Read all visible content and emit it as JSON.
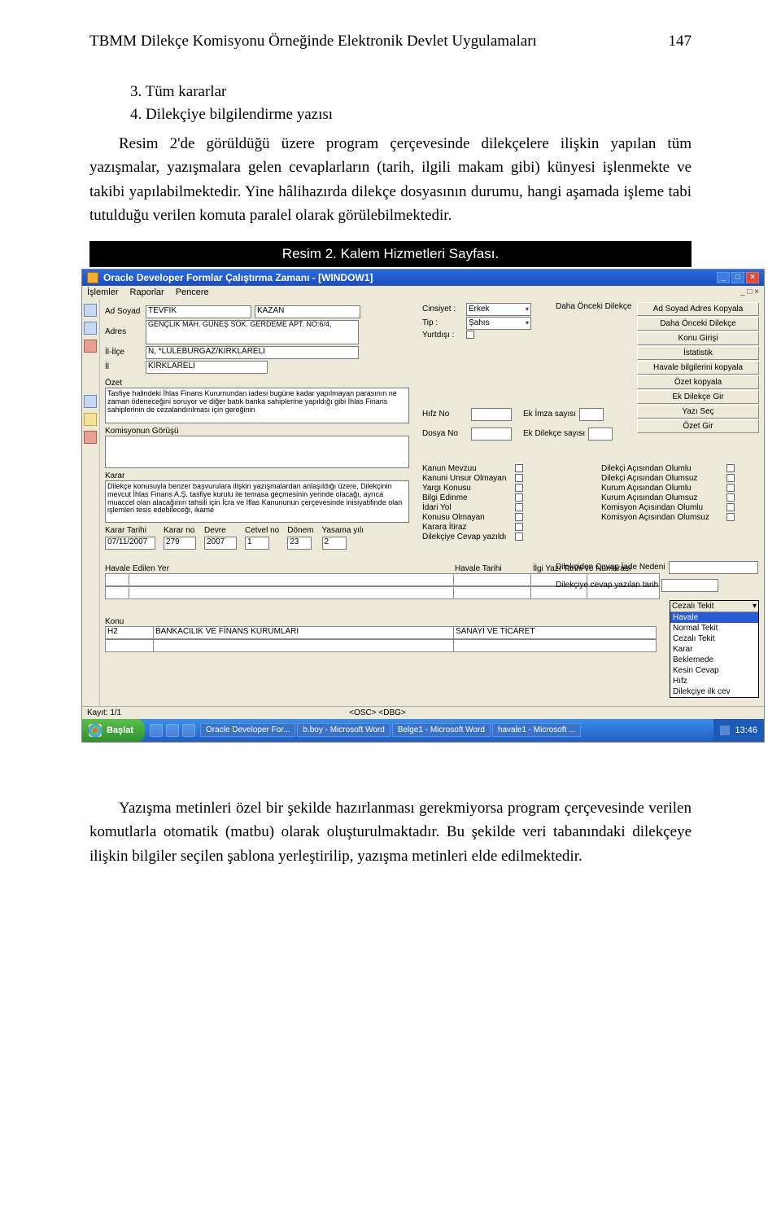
{
  "header": {
    "title": "TBMM Dilekçe Komisyonu Örneğinde Elektronik Devlet Uygulamaları",
    "page": "147"
  },
  "list": {
    "i3": "3. Tüm kararlar",
    "i4": "4. Dilekçiye bilgilendirme yazısı"
  },
  "para1": "Resim 2'de görüldüğü üzere program çerçevesinde dilekçelere ilişkin yapılan tüm yazışmalar, yazışmalara gelen cevaplarların (tarih, ilgili makam gibi) künyesi işlenmekte ve takibi yapılabilmektedir. Yine hâlihazırda dilekçe dosyasının durumu, hangi aşamada işleme tabi tutulduğu verilen komuta paralel olarak görülebilmektedir.",
  "caption": "Resim 2. Kalem Hizmetleri Sayfası.",
  "window": {
    "title": "Oracle Developer Formlar Çalıştırma Zamanı - [WINDOW1]"
  },
  "menu": {
    "m1": "İşlemler",
    "m2": "Raporlar",
    "m3": "Pencere"
  },
  "labels": {
    "ad": "Ad Soyad",
    "adres": "Adres",
    "ililce": "İl-İlçe",
    "il": "İl",
    "cins": "Cinsiyet :",
    "tip": "Tip       :",
    "yurt": "Yurtdışı :",
    "daha": "Daha Önceki Dilekçe",
    "ozet": "Özet",
    "hifz": "Hıfz No",
    "dosya": "Dosya No",
    "ekimza": "Ek İmza sayısı",
    "ekdilek": "Ek Dilekçe sayısı",
    "komgor": "Komisyonun Görüşü",
    "karar": "Karar",
    "kanmevzu": "Kanun Mevzuu",
    "kanuns": "Kanuni Unsur Olmayan",
    "yargi": "Yargı Konusu",
    "bilgi": "Bilgi Edinme",
    "idari": "İdari Yol",
    "konol": "Konusu Olmayan",
    "itiraz": "Karara  İtiraz",
    "cevapyaz": "Dilekçiye Cevap yazıldı",
    "dkolum": "Dilekçi Açısından Olumlu",
    "dkolumz": "Dilekçi Açısından Olumsuz",
    "kuolum": "Kurum Açısından Olumlu",
    "kuolumz": "Kurum Açısından Olumsuz",
    "koolum": "Komisyon Açısından Olumlu",
    "koolumz": "Komisyon Açısından Olumsuz",
    "ktarih": "Karar Tarihi",
    "kno": "Karar no",
    "devre": "Devre",
    "cetvel": "Cetvel no",
    "donem": "Dönem",
    "yasama": "Yasama yılı",
    "dilcevap": "Dilekçiden Cevap İade Nedeni",
    "dilcevtar": "Dilekçiye cevap yazılan tarih",
    "havedilen": "Havale Edilen Yer",
    "havtarih": "Havale Tarihi",
    "ilgiyazi": "İlgi Yazı Tarihi ve Numarası",
    "konu": "Konu"
  },
  "form": {
    "ad1": "TEVFİK",
    "ad2": "KAZAN",
    "adres": "GENÇLİK MAH. GÜNEŞ SOK. GERDEME APT. NO:6/4,",
    "ililce": "N, *LÜLEBURGAZ/KIRKLARELİ",
    "il": "KIRKLARELİ",
    "cins": "Erkek",
    "tip": "Şahıs",
    "ozet": "Tasfiye halindeki İhlas Finans Kurumundan iadesi bugüne kadar yapılmayan parasının ne zaman ödeneceğini soruyor ve diğer batık banka sahiplerine yapıldığı gibi İhlas Finans sahiplerinin de cezalandırılması için gereğinin",
    "komgor": "",
    "karar": "Dilekçe konusuyla benzer başvurulara ilişkin yazışmalardan anlaşıldığı üzere, Dilekçinin mevcut İhlas Finans A.Ş. tasfiye kurulu ile temasa geçmesinin yerinde olacağı, ayrıca muaccel olan alacağının tahsili için İcra ve İflas Kanununun çerçevesinde inisiyatifinde olan işlemleri tesis edebileceği, ikame",
    "ktarih": "07/11/2007",
    "kno": "279",
    "devre": "2007",
    "cetvel": "1",
    "donem": "23",
    "yasama": "2",
    "konu1": "H2",
    "konu2": "BANKACILIK VE FİNANS KURUMLARI",
    "konu3": "SANAYİ VE TİCARET"
  },
  "rbtns": [
    "Ad Soyad Adres Kopyala",
    "Daha Önceki Dilekçe",
    "Konu Girişi",
    "İstatistik",
    "Havale bilgilerini kopyala",
    "Özet kopyala",
    "Ek Dilekçe Gir",
    "Yazı Seç",
    "Özet Gir"
  ],
  "dropdown": {
    "head": "Cezalı Tekit",
    "opts": [
      "Havale",
      "Normal Tekit",
      "Cezalı Tekit",
      "Karar",
      "Beklemede",
      "Kesin Cevap",
      "Hıfz",
      "Dilekçiye ilk cev"
    ]
  },
  "status": {
    "kayit": "Kayıt: 1/1",
    "mid": "<OSC> <DBG>"
  },
  "taskbar": {
    "start": "Başlat",
    "t1": "Oracle Developer For...",
    "t2": "b.boy - Microsoft Word",
    "t3": "Belge1 - Microsoft Word",
    "t4": "havale1 - Microsoft ...",
    "clock": "13:46"
  },
  "para2": "Yazışma metinleri özel bir şekilde hazırlanması gerekmiyorsa program çerçevesinde verilen komutlarla otomatik (matbu) olarak oluşturulmaktadır. Bu şekilde veri tabanındaki dilekçeye ilişkin bilgiler seçilen şablona yerleştirilip, yazışma metinleri elde edilmektedir."
}
